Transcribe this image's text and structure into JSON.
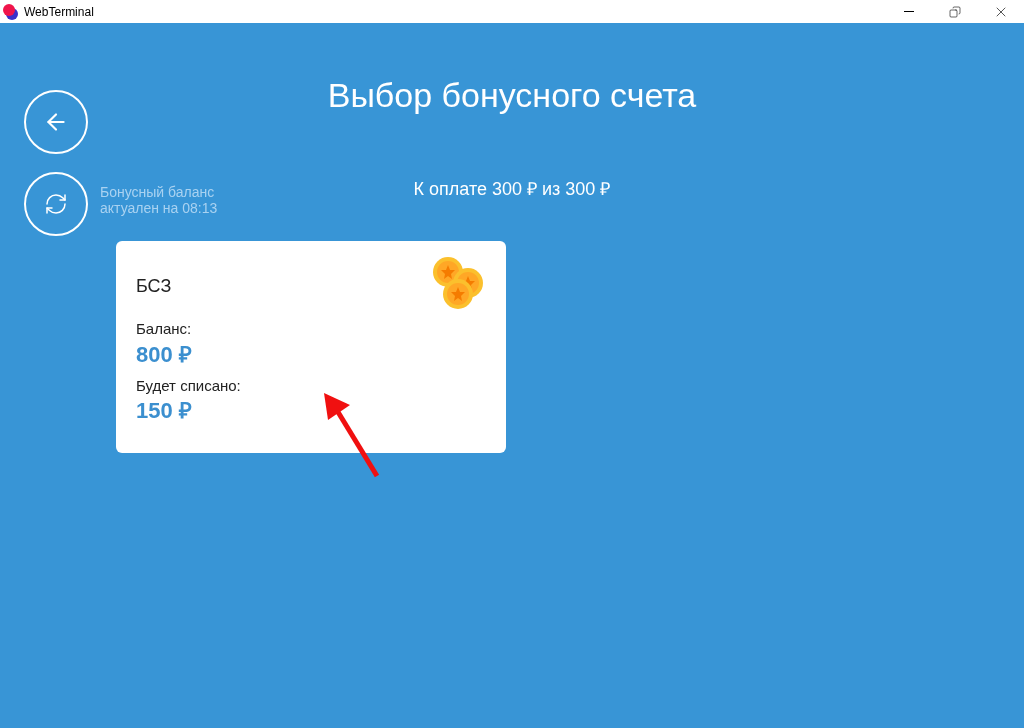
{
  "window": {
    "title": "WebTerminal"
  },
  "page": {
    "title": "Выбор бонусного счета",
    "payment": "К оплате 300 ₽ из 300 ₽",
    "balance_note": [
      "Бонусный баланс",
      "актуален на 08:13"
    ]
  },
  "accounts": [
    {
      "name": "БСЗ",
      "balance_label": "Баланс:",
      "balance": "800 ₽",
      "charge_label": "Будет списано:",
      "charge": "150 ₽"
    }
  ]
}
